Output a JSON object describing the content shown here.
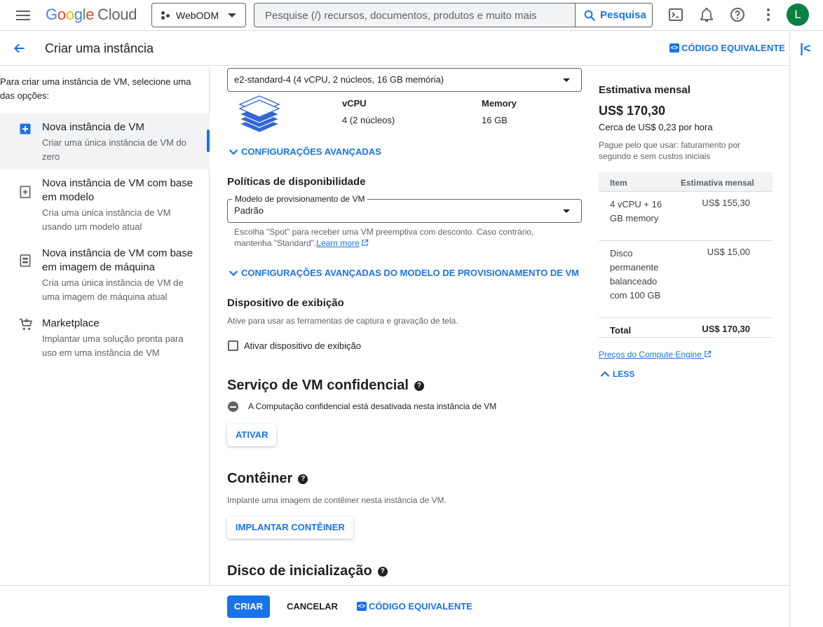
{
  "topbar": {
    "logo_google": [
      "G",
      "o",
      "o",
      "g",
      "l",
      "e"
    ],
    "logo_cloud": "Cloud",
    "project_name": "WebODM",
    "search_placeholder": "Pesquise (/) recursos, documentos, produtos e muito mais",
    "search_button": "Pesquisa",
    "avatar_letter": "L"
  },
  "header": {
    "title": "Criar uma instância",
    "code_equivalent": "CÓDIGO EQUIVALENTE"
  },
  "leftnav": {
    "intro": "Para criar uma instância de VM, selecione uma das opções:",
    "items": [
      {
        "title": "Nova instância de VM",
        "desc": "Criar uma única instância de VM do zero",
        "icon": "add-box-icon"
      },
      {
        "title": "Nova instância de VM com base em modelo",
        "desc": "Cria uma única instância de VM usando um modelo atual",
        "icon": "template-icon"
      },
      {
        "title": "Nova instância de VM com base em imagem de máquina",
        "desc": "Cria uma única instância de VM de uma imagem de máquina atual",
        "icon": "machine-image-icon"
      },
      {
        "title": "Marketplace",
        "desc": "Implantar uma solução pronta para uso em uma instância de VM",
        "icon": "cart-icon"
      }
    ]
  },
  "main": {
    "machine_type": "e2-standard-4 (4 vCPU, 2 núcleos, 16 GB memória)",
    "vcpu_label": "vCPU",
    "vcpu_value": "4 (2 núcleos)",
    "memory_label": "Memory",
    "memory_value": "16 GB",
    "advanced_config": "CONFIGURAÇÕES AVANÇADAS",
    "availability_title": "Políticas de disponibilidade",
    "provisioning_label": "Modelo de provisionamento de VM",
    "provisioning_value": "Padrão",
    "provisioning_hint": "Escolha \"Spot\" para receber uma VM preemptiva com desconto. Caso contrário, mantenha \"Standard\".",
    "learn_more": "Learn more",
    "advanced_provisioning": "CONFIGURAÇÕES AVANÇADAS DO MODELO DE PROVISIONAMENTO DE VM",
    "display_title": "Dispositivo de exibição",
    "display_desc": "Ative para usar as ferramentas de captura e gravação de tela.",
    "display_checkbox": "Ativar dispositivo de exibição",
    "confidential_title": "Serviço de VM confidencial",
    "confidential_status": "A Computação confidencial está desativada nesta instância de VM",
    "activate_button": "ATIVAR",
    "container_title": "Contêiner",
    "container_desc": "Implante uma imagem de contêiner nesta instância de VM.",
    "deploy_container_button": "IMPLANTAR CONTÊINER",
    "boot_disk_title": "Disco de inicialização"
  },
  "cost": {
    "title": "Estimativa mensal",
    "price": "US$ 170,30",
    "hourly": "Cerca de US$ 0,23 por hora",
    "payg": "Pague pelo que usar: faturamento por segundo e sem custos iniciais",
    "col_item": "Item",
    "col_estimate": "Estimativa mensal",
    "rows": [
      {
        "item": "4 vCPU + 16 GB memory",
        "amount": "US$ 155,30"
      },
      {
        "item": "Disco permanente balanceado com 100 GB",
        "amount": "US$ 15,00"
      },
      {
        "item": "Total",
        "amount": "US$ 170,30"
      }
    ],
    "pricing_link": "Preços do Compute Engine",
    "less": "LESS"
  },
  "footer": {
    "create": "CRIAR",
    "cancel": "CANCELAR",
    "code_equivalent": "CÓDIGO EQUIVALENTE"
  }
}
